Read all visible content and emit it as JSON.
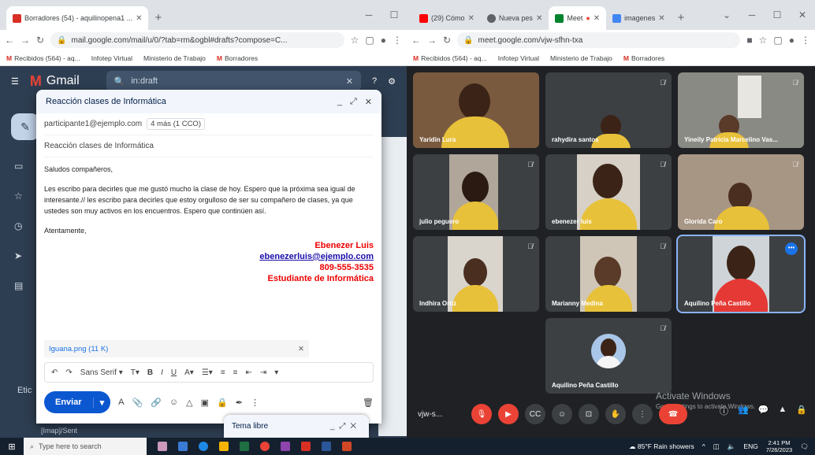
{
  "left_window": {
    "tabs": [
      {
        "label": "Borradores (54) - aquilinopena1 ...",
        "active": true,
        "fav_color": "#d93025"
      }
    ],
    "url": "mail.google.com/mail/u/0/?tab=rm&ogbl#drafts?compose=C...",
    "bookmarks": [
      "Recibidos (564) - aq...",
      "Infotep Virtual",
      "Ministerio de Trabajo",
      "Borradores"
    ]
  },
  "right_window": {
    "tabs": [
      {
        "label": "(29) Cómo",
        "active": false,
        "fav_color": "#ff0000"
      },
      {
        "label": "Nueva pes",
        "active": false,
        "fav_color": "#5f6368"
      },
      {
        "label": "Meet",
        "active": true,
        "fav_color": "#00832d"
      },
      {
        "label": "imagenes",
        "active": false,
        "fav_color": "#4285f4"
      }
    ],
    "url": "meet.google.com/vjw-sfhn-txa",
    "bookmarks": [
      "Recibidos (564) - aq...",
      "Infotep Virtual",
      "Ministerio de Trabajo",
      "Borradores"
    ]
  },
  "gmail": {
    "logo": "Gmail",
    "search_value": "in:draft",
    "labels_heading": "Etic",
    "imap_item": "[Imap]/Sent"
  },
  "compose": {
    "title": "Reacción clases de Informática",
    "to": "participante1@ejemplo.com",
    "bcc_chip": "4 más (1 CCO)",
    "subject": "Reacción clases de Informática",
    "greeting": "Saludos compañeros,",
    "body": "Les escribo para decirles que me gustó mucho la clase de hoy. Espero que la próxima sea igual de interesante.// les escribo para decirles que estoy orgulloso de ser su compañero de clases, ya que ustedes son muy activos en los encuentros. Espero que continúen así.",
    "closing": "Atentamente,",
    "signature": {
      "name": "Ebenezer Luis",
      "email": "ebenezerluis@ejemplo.com",
      "phone": "809-555-3535",
      "role": "Estudiante de Informática"
    },
    "attachment": "Iguana.png (11 K)",
    "font_name": "Sans Serif",
    "send_label": "Enviar"
  },
  "minimized_draft": {
    "title": "Tema libre"
  },
  "meet": {
    "participants": [
      {
        "name": "Yaridin Lura"
      },
      {
        "name": "rahydira santos"
      },
      {
        "name": "Yineily Patricia Marcelino Vas..."
      },
      {
        "name": "julio peguero"
      },
      {
        "name": "ebenezer luis"
      },
      {
        "name": "Glorida Caro"
      },
      {
        "name": "Indhira Ortiz"
      },
      {
        "name": "Marianny Medina"
      },
      {
        "name": "Aquilino Peña Castillo"
      },
      {
        "name": "Aquilino Peña Castillo"
      }
    ],
    "meeting_code": "vjw-s...",
    "watermark_title": "Activate Windows",
    "watermark_sub": "Go to Settings to activate Windows."
  },
  "taskbar": {
    "search_placeholder": "Type here to search",
    "weather": "85°F  Rain showers",
    "lang": "ENG",
    "time": "2:41 PM",
    "date": "7/26/2023"
  }
}
